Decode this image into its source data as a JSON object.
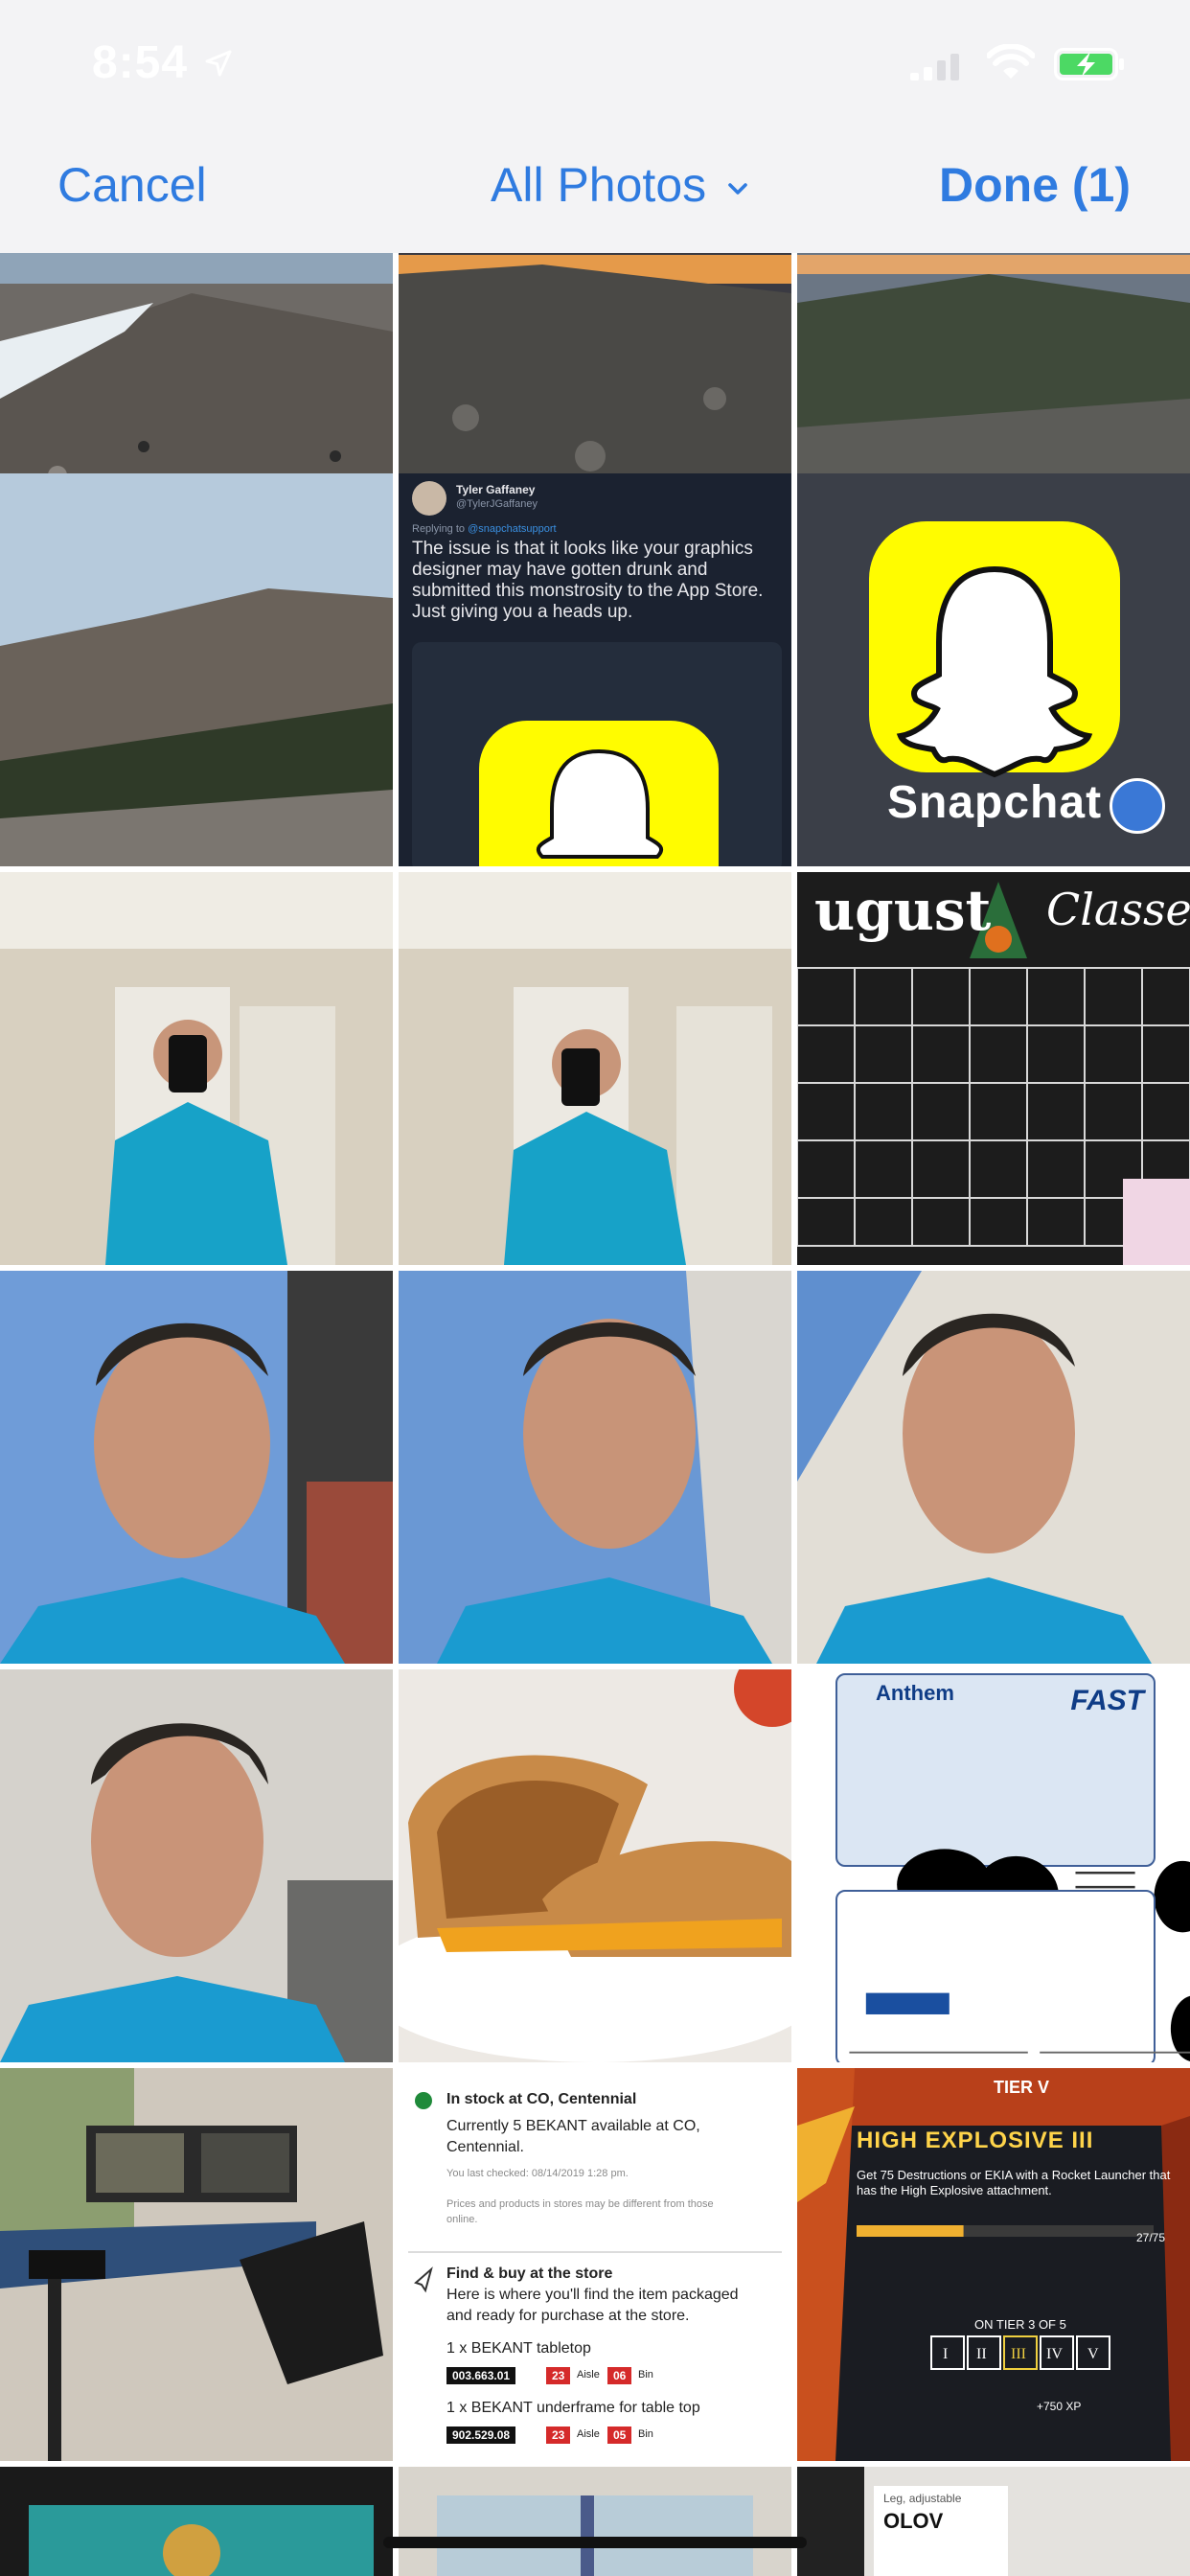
{
  "status_bar": {
    "time": "8:54"
  },
  "nav": {
    "cancel_label": "Cancel",
    "album_label": "All Photos",
    "done_label": "Done (1)"
  },
  "photos": {
    "tweet": {
      "name": "Tyler Gaffaney",
      "handle": "@TylerJGaffaney",
      "replying_prefix": "Replying to ",
      "replying_to": "@snapchatsupport",
      "text": "The issue is that it looks like your graphics designer may have gotten drunk and submitted this monstrosity to the App Store. Just giving you a heads up."
    },
    "snapchat": {
      "label": "Snapchat",
      "selected": true
    },
    "calendar": {
      "title": "ugust",
      "subtitle": "Classes"
    },
    "insurance": {
      "brand": "Anthem",
      "logo_text": "FAST"
    },
    "store": {
      "stock_heading": "In stock at CO, Centennial",
      "stock_line1": "Currently 5 BEKANT available at CO,",
      "stock_line2": "Centennial.",
      "last_checked": "You last checked: 08/14/2019 1:28 pm.",
      "disclaimer1": "Prices and products in stores may be different from those",
      "disclaimer2": "online.",
      "find_heading": "Find & buy at the store",
      "find_line1": "Here is where you'll find the item packaged",
      "find_line2": "and ready for purchase at the store.",
      "item1": "1 x BEKANT tabletop",
      "item1_code": "003.663.01",
      "item1_aisle": "23",
      "item1_aisle_label": "Aisle",
      "item1_bin": "06",
      "item1_bin_label": "Bin",
      "item2": "1 x BEKANT underframe for table top",
      "item2_code": "902.529.08",
      "item2_aisle": "23",
      "item2_aisle_label": "Aisle",
      "item2_bin": "05",
      "item2_bin_label": "Bin"
    },
    "game": {
      "tier": "TIER V",
      "title": "HIGH EXPLOSIVE III",
      "desc": "Get 75 Destructions or EKIA with a Rocket Launcher that has the High Explosive attachment.",
      "progress_text": "27/75",
      "progress": 0.36,
      "tier_of": "ON TIER 3 OF 5",
      "xp": "+750 XP"
    },
    "tag": {
      "line1": "Leg, adjustable",
      "line2": "OLOV"
    }
  },
  "colors": {
    "accent": "#2f7be0",
    "bar_bg": "#f3f3f5",
    "check": "#3a78d6"
  }
}
